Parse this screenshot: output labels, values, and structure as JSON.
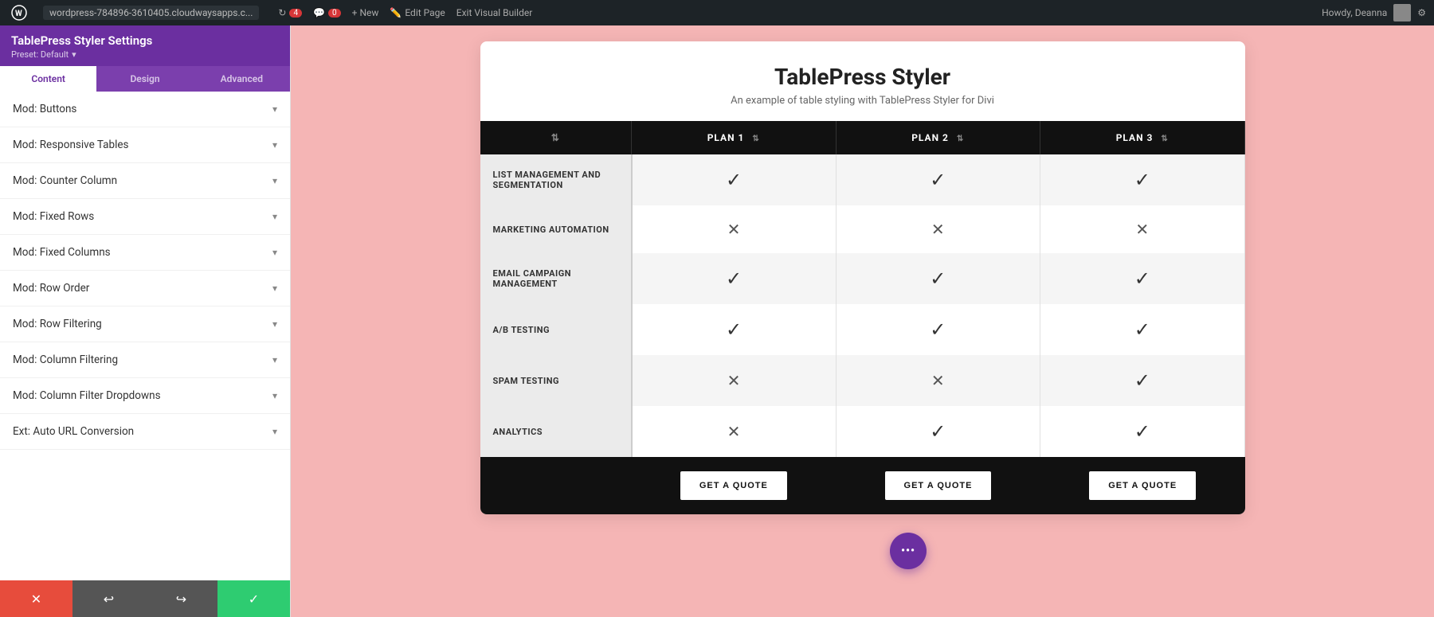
{
  "topbar": {
    "wp_icon": "W",
    "url": "wordpress-784896-3610405.cloudwaysapps.c...",
    "refresh_count": "4",
    "comment_count": "0",
    "new_label": "+ New",
    "edit_page_label": "Edit Page",
    "exit_builder_label": "Exit Visual Builder",
    "howdy": "Howdy, Deanna"
  },
  "sidebar": {
    "title": "TablePress Styler Settings",
    "preset_label": "Preset: Default",
    "tabs": [
      {
        "label": "Content",
        "active": true
      },
      {
        "label": "Design",
        "active": false
      },
      {
        "label": "Advanced",
        "active": false
      }
    ],
    "items": [
      {
        "label": "Mod: Buttons"
      },
      {
        "label": "Mod: Responsive Tables"
      },
      {
        "label": "Mod: Counter Column"
      },
      {
        "label": "Mod: Fixed Rows"
      },
      {
        "label": "Mod: Fixed Columns"
      },
      {
        "label": "Mod: Row Order"
      },
      {
        "label": "Mod: Row Filtering"
      },
      {
        "label": "Mod: Column Filtering"
      },
      {
        "label": "Mod: Column Filter Dropdowns"
      },
      {
        "label": "Ext: Auto URL Conversion"
      }
    ],
    "footer": {
      "cancel_icon": "✕",
      "undo_icon": "↩",
      "redo_icon": "↪",
      "save_icon": "✓"
    }
  },
  "table_card": {
    "title": "TablePress Styler",
    "subtitle": "An example of table styling with TablePress Styler for Divi",
    "header_cols": [
      {
        "label": ""
      },
      {
        "label": "PLAN 1"
      },
      {
        "label": "PLAN 2"
      },
      {
        "label": "PLAN 3"
      }
    ],
    "rows": [
      {
        "feature": "LIST MANAGEMENT AND SEGMENTATION",
        "plan1": "check",
        "plan2": "check",
        "plan3": "check"
      },
      {
        "feature": "MARKETING AUTOMATION",
        "plan1": "cross",
        "plan2": "cross",
        "plan3": "cross"
      },
      {
        "feature": "EMAIL CAMPAIGN MANAGEMENT",
        "plan1": "check",
        "plan2": "check",
        "plan3": "check"
      },
      {
        "feature": "A/B TESTING",
        "plan1": "check",
        "plan2": "check",
        "plan3": "check"
      },
      {
        "feature": "SPAM TESTING",
        "plan1": "cross",
        "plan2": "cross",
        "plan3": "check"
      },
      {
        "feature": "ANALYTICS",
        "plan1": "cross",
        "plan2": "check",
        "plan3": "check"
      }
    ],
    "footer_buttons": [
      {
        "label": "GET A QUOTE"
      },
      {
        "label": "GET A QUOTE"
      },
      {
        "label": "GET A QUOTE"
      }
    ]
  },
  "fab": {
    "icon": "⋯"
  },
  "icons": {
    "check": "✓",
    "cross": "✕",
    "chevron_down": "▾",
    "sort": "⇅"
  }
}
